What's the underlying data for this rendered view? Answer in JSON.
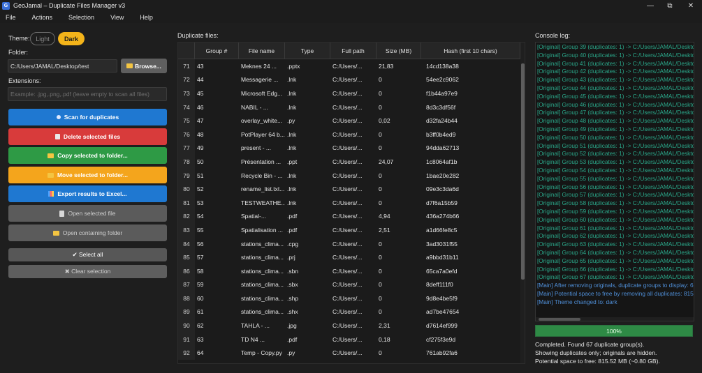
{
  "window": {
    "title": "GeoJamal – Duplicate Files Manager v3",
    "minimize": "—",
    "maximize": "⧉",
    "close": "✕"
  },
  "menu": [
    "File",
    "Actions",
    "Selection",
    "View",
    "Help"
  ],
  "left": {
    "theme_label": "Theme:",
    "theme_light": "Light",
    "theme_dark": "Dark",
    "theme_selected": "Dark",
    "folder_label": "Folder:",
    "folder_value": "C:/Users/JAMAL/Desktop/test",
    "browse_label": "Browse...",
    "extensions_label": "Extensions:",
    "extensions_placeholder": "Example: .jpg,.png,.pdf (leave empty to scan all files)",
    "buttons": {
      "scan": "Scan for duplicates",
      "delete": "Delete selected files",
      "copy": "Copy selected to folder...",
      "move": "Move selected to folder...",
      "export": "Export results to Excel...",
      "open_file": "Open selected file",
      "open_folder": "Open containing folder",
      "select_all": "✔ Select all",
      "clear": "✖ Clear selection"
    },
    "colors": {
      "scan": "#1f78d1",
      "delete": "#d83b3b",
      "copy": "#2e9a45",
      "move": "#f4a51c",
      "export": "#1f78d1",
      "disabled": "#5b5b5b",
      "neutral": "#575757",
      "neutral_disabled": "#5e5e5e"
    }
  },
  "table": {
    "label": "Duplicate files:",
    "headers": [
      "Group #",
      "File name",
      "Type",
      "Full path",
      "Size (MB)",
      "Hash (first 10 chars)"
    ],
    "rows": [
      {
        "n": "71",
        "group": "43",
        "name": "Meknes 24 ...",
        "type": ".pptx",
        "path": "C:/Users/...",
        "size": "21,83",
        "hash": "14cd138a38"
      },
      {
        "n": "72",
        "group": "44",
        "name": "Messagerie ...",
        "type": ".lnk",
        "path": "C:/Users/...",
        "size": "0",
        "hash": "54ee2c9062"
      },
      {
        "n": "73",
        "group": "45",
        "name": "Microsoft Edg...",
        "type": ".lnk",
        "path": "C:/Users/...",
        "size": "0",
        "hash": "f1b44a97e9"
      },
      {
        "n": "74",
        "group": "46",
        "name": "NABIL - ...",
        "type": ".lnk",
        "path": "C:/Users/...",
        "size": "0",
        "hash": "8d3c3df56f"
      },
      {
        "n": "75",
        "group": "47",
        "name": "overlay_white...",
        "type": ".py",
        "path": "C:/Users/...",
        "size": "0,02",
        "hash": "d32fa24b44"
      },
      {
        "n": "76",
        "group": "48",
        "name": "PotPlayer 64 b...",
        "type": ".lnk",
        "path": "C:/Users/...",
        "size": "0",
        "hash": "b3ff0b4ed9"
      },
      {
        "n": "77",
        "group": "49",
        "name": "present - ...",
        "type": ".lnk",
        "path": "C:/Users/...",
        "size": "0",
        "hash": "94dda62713"
      },
      {
        "n": "78",
        "group": "50",
        "name": "Présentation ...",
        "type": ".ppt",
        "path": "C:/Users/...",
        "size": "24,07",
        "hash": "1c8064af1b"
      },
      {
        "n": "79",
        "group": "51",
        "name": "Recycle Bin - ...",
        "type": ".lnk",
        "path": "C:/Users/...",
        "size": "0",
        "hash": "1bae20e282"
      },
      {
        "n": "80",
        "group": "52",
        "name": "rename_list.txt...",
        "type": ".lnk",
        "path": "C:/Users/...",
        "size": "0",
        "hash": "09e3c3da6d"
      },
      {
        "n": "81",
        "group": "53",
        "name": "TESTWEATHE...",
        "type": ".lnk",
        "path": "C:/Users/...",
        "size": "0",
        "hash": "d7f6a15b59"
      },
      {
        "n": "82",
        "group": "54",
        "name": "Spatial-...",
        "type": ".pdf",
        "path": "C:/Users/...",
        "size": "4,94",
        "hash": "436a274b66"
      },
      {
        "n": "83",
        "group": "55",
        "name": "Spatialisation ...",
        "type": ".pdf",
        "path": "C:/Users/...",
        "size": "2,51",
        "hash": "a1d66fe8c5"
      },
      {
        "n": "84",
        "group": "56",
        "name": "stations_clima...",
        "type": ".cpg",
        "path": "C:/Users/...",
        "size": "0",
        "hash": "3ad3031f55"
      },
      {
        "n": "85",
        "group": "57",
        "name": "stations_clima...",
        "type": ".prj",
        "path": "C:/Users/...",
        "size": "0",
        "hash": "a9bbd31b11"
      },
      {
        "n": "86",
        "group": "58",
        "name": "stations_clima...",
        "type": ".sbn",
        "path": "C:/Users/...",
        "size": "0",
        "hash": "65ca7a0efd"
      },
      {
        "n": "87",
        "group": "59",
        "name": "stations_clima...",
        "type": ".sbx",
        "path": "C:/Users/...",
        "size": "0",
        "hash": "8deff111f0"
      },
      {
        "n": "88",
        "group": "60",
        "name": "stations_clima...",
        "type": ".shp",
        "path": "C:/Users/...",
        "size": "0",
        "hash": "9d8e4be5f9"
      },
      {
        "n": "89",
        "group": "61",
        "name": "stations_clima...",
        "type": ".shx",
        "path": "C:/Users/...",
        "size": "0",
        "hash": "ad7be47654"
      },
      {
        "n": "90",
        "group": "62",
        "name": "TAHLA - ...",
        "type": ".jpg",
        "path": "C:/Users/...",
        "size": "2,31",
        "hash": "d7614ef999"
      },
      {
        "n": "91",
        "group": "63",
        "name": "TD N4 ...",
        "type": ".pdf",
        "path": "C:/Users/...",
        "size": "0,18",
        "hash": "cf275f3e9d"
      },
      {
        "n": "92",
        "group": "64",
        "name": "Temp - Copy.py",
        "type": ".py",
        "path": "C:/Users/...",
        "size": "0",
        "hash": "761ab92fa6"
      }
    ]
  },
  "console": {
    "label": "Console log:",
    "lines": [
      {
        "text": "[Original] Group 39 (duplicates: 1) -> C:/Users/JAMAL/Desktop/test",
        "kind": "orig"
      },
      {
        "text": "[Original] Group 40 (duplicates: 1) -> C:/Users/JAMAL/Desktop/test",
        "kind": "orig"
      },
      {
        "text": "[Original] Group 41 (duplicates: 1) -> C:/Users/JAMAL/Desktop/test",
        "kind": "orig"
      },
      {
        "text": "[Original] Group 42 (duplicates: 1) -> C:/Users/JAMAL/Desktop/test",
        "kind": "orig"
      },
      {
        "text": "[Original] Group 43 (duplicates: 1) -> C:/Users/JAMAL/Desktop/test",
        "kind": "orig"
      },
      {
        "text": "[Original] Group 44 (duplicates: 1) -> C:/Users/JAMAL/Desktop/test",
        "kind": "orig"
      },
      {
        "text": "[Original] Group 45 (duplicates: 1) -> C:/Users/JAMAL/Desktop/test",
        "kind": "orig"
      },
      {
        "text": "[Original] Group 46 (duplicates: 1) -> C:/Users/JAMAL/Desktop/test",
        "kind": "orig"
      },
      {
        "text": "[Original] Group 47 (duplicates: 1) -> C:/Users/JAMAL/Desktop/test",
        "kind": "orig"
      },
      {
        "text": "[Original] Group 48 (duplicates: 1) -> C:/Users/JAMAL/Desktop/test",
        "kind": "orig"
      },
      {
        "text": "[Original] Group 49 (duplicates: 1) -> C:/Users/JAMAL/Desktop/test",
        "kind": "orig"
      },
      {
        "text": "[Original] Group 50 (duplicates: 1) -> C:/Users/JAMAL/Desktop/test",
        "kind": "orig"
      },
      {
        "text": "[Original] Group 51 (duplicates: 1) -> C:/Users/JAMAL/Desktop/test",
        "kind": "orig"
      },
      {
        "text": "[Original] Group 52 (duplicates: 1) -> C:/Users/JAMAL/Desktop/test",
        "kind": "orig"
      },
      {
        "text": "[Original] Group 53 (duplicates: 1) -> C:/Users/JAMAL/Desktop/test",
        "kind": "orig"
      },
      {
        "text": "[Original] Group 54 (duplicates: 1) -> C:/Users/JAMAL/Desktop/test",
        "kind": "orig"
      },
      {
        "text": "[Original] Group 55 (duplicates: 1) -> C:/Users/JAMAL/Desktop/test",
        "kind": "orig"
      },
      {
        "text": "[Original] Group 56 (duplicates: 1) -> C:/Users/JAMAL/Desktop/test",
        "kind": "orig"
      },
      {
        "text": "[Original] Group 57 (duplicates: 1) -> C:/Users/JAMAL/Desktop/test",
        "kind": "orig"
      },
      {
        "text": "[Original] Group 58 (duplicates: 1) -> C:/Users/JAMAL/Desktop/test",
        "kind": "orig"
      },
      {
        "text": "[Original] Group 59 (duplicates: 1) -> C:/Users/JAMAL/Desktop/test",
        "kind": "orig"
      },
      {
        "text": "[Original] Group 60 (duplicates: 1) -> C:/Users/JAMAL/Desktop/test",
        "kind": "orig"
      },
      {
        "text": "[Original] Group 61 (duplicates: 1) -> C:/Users/JAMAL/Desktop/test",
        "kind": "orig"
      },
      {
        "text": "[Original] Group 62 (duplicates: 1) -> C:/Users/JAMAL/Desktop/test",
        "kind": "orig"
      },
      {
        "text": "[Original] Group 63 (duplicates: 1) -> C:/Users/JAMAL/Desktop/test",
        "kind": "orig"
      },
      {
        "text": "[Original] Group 64 (duplicates: 1) -> C:/Users/JAMAL/Desktop/test",
        "kind": "orig"
      },
      {
        "text": "[Original] Group 65 (duplicates: 1) -> C:/Users/JAMAL/Desktop/test",
        "kind": "orig"
      },
      {
        "text": "[Original] Group 66 (duplicates: 1) -> C:/Users/JAMAL/Desktop/test",
        "kind": "orig"
      },
      {
        "text": "[Original] Group 67 (duplicates: 1) -> C:/Users/JAMAL/Desktop/test",
        "kind": "orig"
      },
      {
        "text": "[Main] After removing originals, duplicate groups to display: 67",
        "kind": "main"
      },
      {
        "text": "[Main] Potential space to free by removing all duplicates: 815.52 MB",
        "kind": "main"
      },
      {
        "text": "[Main] Theme changed to: dark",
        "kind": "main"
      }
    ]
  },
  "progress": {
    "value": 1.0,
    "label": "100%"
  },
  "status": {
    "line1": "Completed. Found 67 duplicate group(s).",
    "line2": "Showing duplicates only; originals are hidden.",
    "line3": "Potential space to free: 815.52 MB (~0.80 GB)."
  }
}
